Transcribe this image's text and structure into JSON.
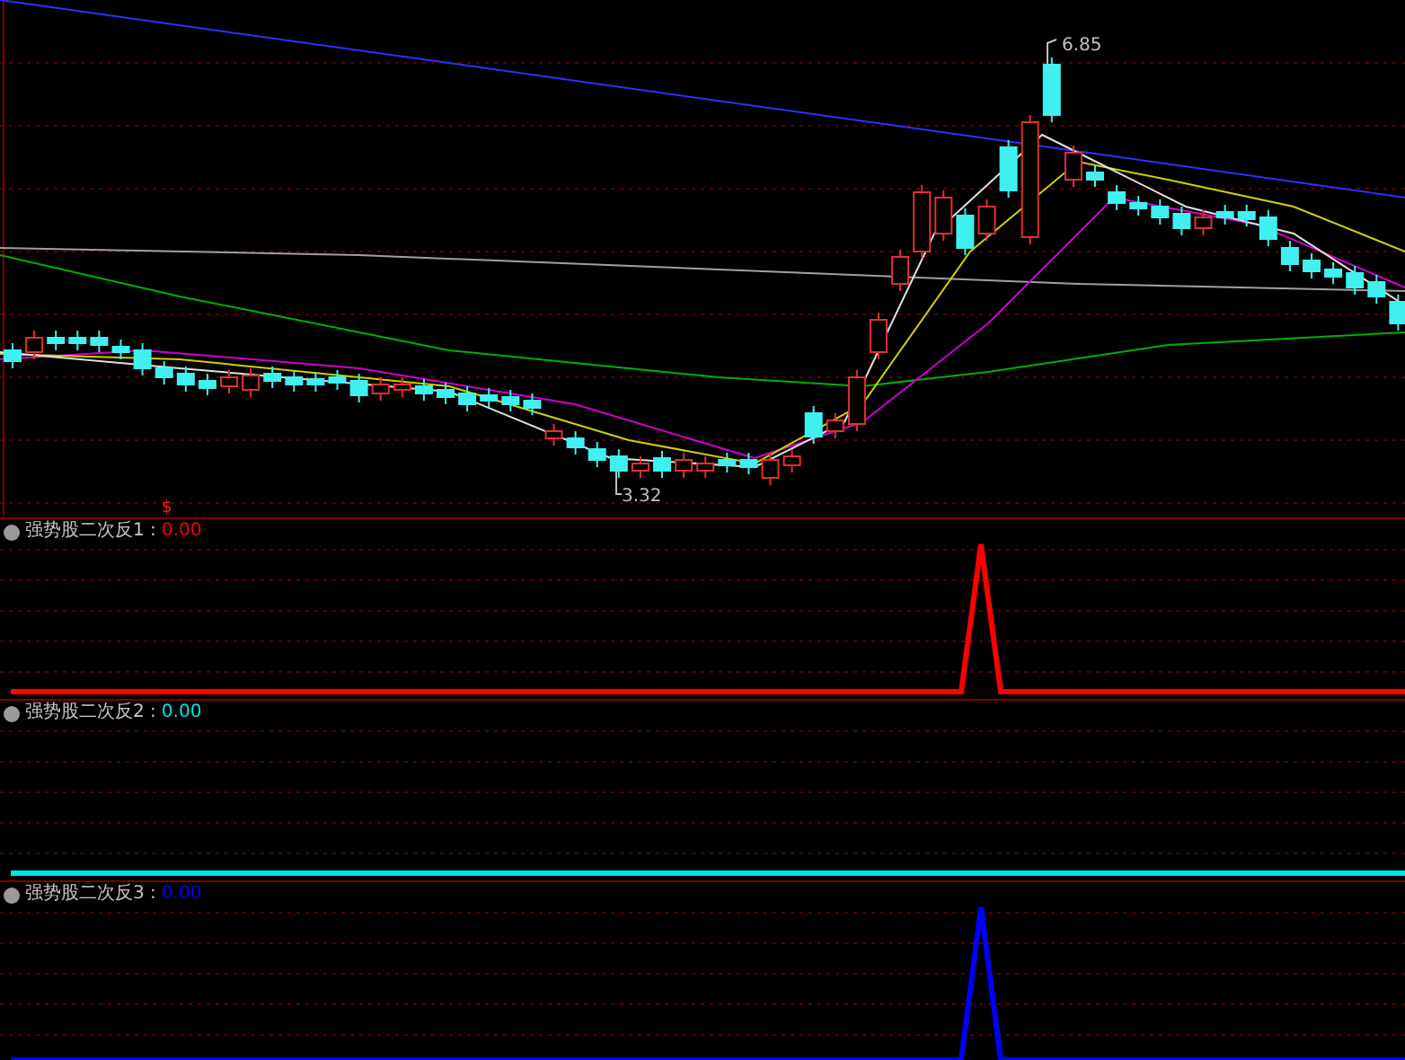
{
  "price_panel": {
    "high_label": "6.85",
    "low_label": "3.32",
    "signal_marker": "$"
  },
  "indicators": [
    {
      "label": "强势股二次反1 :",
      "value": "0.00",
      "color": "#ff0000",
      "kind": "spike"
    },
    {
      "label": "强势股二次反2 :",
      "value": "0.00",
      "color": "#00e5e5",
      "kind": "flat"
    },
    {
      "label": "强势股二次反3 :",
      "value": "0.00",
      "color": "#0000ff",
      "kind": "spike"
    }
  ]
}
